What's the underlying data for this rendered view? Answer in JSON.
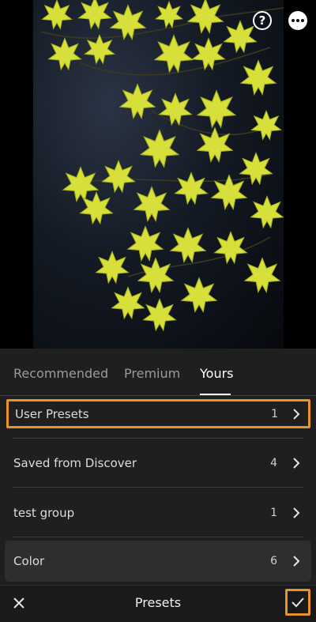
{
  "toolbar": {
    "help_icon": "help-circle-icon",
    "more_icon": "more-options-icon"
  },
  "tabs": [
    {
      "label": "Recommended",
      "active": false
    },
    {
      "label": "Premium",
      "active": false
    },
    {
      "label": "Yours",
      "active": true
    }
  ],
  "groups": [
    {
      "label": "User Presets",
      "count": "1",
      "highlighted": true
    },
    {
      "label": "Saved from Discover",
      "count": "4"
    },
    {
      "label": "test group",
      "count": "1"
    },
    {
      "label": "Color",
      "count": "6",
      "selected": true
    }
  ],
  "bottom_bar": {
    "title": "Presets",
    "close_icon": "close-icon",
    "confirm_icon": "checkmark-icon"
  },
  "colors": {
    "accent_highlight": "#e8932a",
    "panel_bg": "#1f1f1f",
    "leaf_color": "#d9e23a"
  }
}
